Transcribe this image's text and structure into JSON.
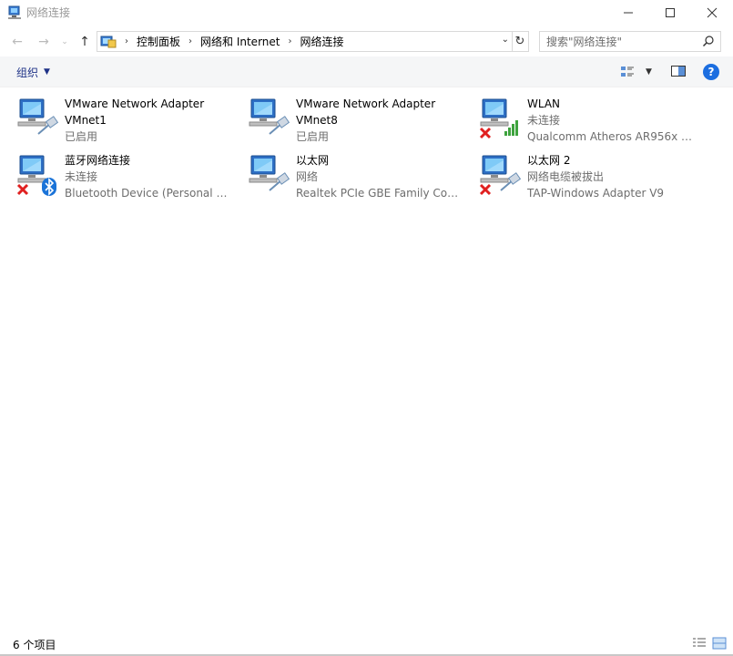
{
  "window": {
    "title": "网络连接",
    "controls": {
      "minimize": "–",
      "maximize": "☐",
      "close": "✕"
    }
  },
  "nav": {
    "back_glyph": "←",
    "forward_glyph": "→",
    "recent_glyph": "⌄",
    "up_glyph": "↑",
    "breadcrumbs": [
      "控制面板",
      "网络和 Internet",
      "网络连接"
    ],
    "search_placeholder": "搜索\"网络连接\""
  },
  "toolbar": {
    "organize_label": "组织",
    "help_label": "?"
  },
  "items": [
    {
      "name": "VMware Network Adapter VMnet1",
      "name_line1": "VMware Network Adapter",
      "name_line2": "VMnet1",
      "status": "已启用",
      "device": "",
      "badge": "cable",
      "disabled": false
    },
    {
      "name": "VMware Network Adapter VMnet8",
      "name_line1": "VMware Network Adapter",
      "name_line2": "VMnet8",
      "status": "已启用",
      "device": "",
      "badge": "cable",
      "disabled": false
    },
    {
      "name": "WLAN",
      "name_line1": "WLAN",
      "name_line2": "",
      "status": "未连接",
      "device": "Qualcomm Atheros AR956x Wi...",
      "badge": "wifi",
      "disabled": true
    },
    {
      "name": "蓝牙网络连接",
      "name_line1": "蓝牙网络连接",
      "name_line2": "",
      "status": "未连接",
      "device": "Bluetooth Device (Personal Ar...",
      "badge": "bluetooth",
      "disabled": true
    },
    {
      "name": "以太网",
      "name_line1": "以太网",
      "name_line2": "",
      "status": "网络",
      "device": "Realtek PCIe GBE Family Contr...",
      "badge": "cable",
      "disabled": false
    },
    {
      "name": "以太网 2",
      "name_line1": "以太网 2",
      "name_line2": "",
      "status": "网络电缆被拔出",
      "device": "TAP-Windows Adapter V9",
      "badge": "cable",
      "disabled": true
    }
  ],
  "status": {
    "count_label": "6 个项目"
  },
  "colors": {
    "accent": "#1e3287",
    "help_blue": "#1c6ee0",
    "disabled_red": "#e02020",
    "wifi_green": "#3ea33e",
    "bluetooth_blue": "#1a73d8"
  }
}
